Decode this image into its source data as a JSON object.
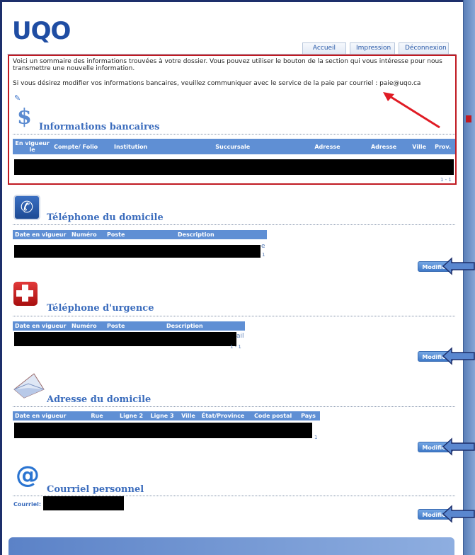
{
  "header": {
    "logo": "UQO",
    "tabs": [
      "Accueil",
      "Impression",
      "Déconnexion"
    ]
  },
  "intro": {
    "line1": "Voici un sommaire des informations trouvées à votre dossier. Vous pouvez utiliser le bouton de la section qui vous intéresse pour nous transmettre une nouvelle information.",
    "line2": "Si vous désirez modifier vos informations bancaires, veuillez communiquer avec le service de la paie par courriel : paie@uqo.ca"
  },
  "banking": {
    "title": "Informations bancaires",
    "icon": "dollar-icon",
    "symbol": "$",
    "columns": [
      "En vigueur le",
      "Compte/ Folio",
      "Institution",
      "Succursale",
      "Adresse",
      "Adresse",
      "Ville",
      "Prov."
    ],
    "pager": "1 - 1"
  },
  "home_phone": {
    "title": "Téléphone du domicile",
    "icon": "phone-icon",
    "columns": [
      "Date en vigueur",
      "Numéro",
      "Poste",
      "Description"
    ],
    "fragment": "e",
    "pager": "1",
    "button": "Modifier"
  },
  "emergency_phone": {
    "title": "Téléphone d'urgence",
    "icon": "cross-icon",
    "columns": [
      "Date en vigueur",
      "Numéro",
      "Poste",
      "Description"
    ],
    "fragment": "ail",
    "pager": "1 - 1",
    "button": "Modifier"
  },
  "home_address": {
    "title": "Adresse du domicile",
    "icon": "envelope-icon",
    "columns": [
      "Date en vigueur",
      "Rue",
      "Ligne 2",
      "Ligne 3",
      "Ville",
      "État/Province",
      "Code postal",
      "Pays"
    ],
    "pager": "1",
    "button": "Modifier"
  },
  "personal_email": {
    "title": "Courriel personnel",
    "icon": "at-icon",
    "symbol": "@",
    "label": "Courriel:",
    "button": "Modifier"
  },
  "colors": {
    "accent": "#3c6dbd",
    "header_blue": "#5f8fd4",
    "highlight_red": "#c01a22",
    "brand": "#1f4da3"
  }
}
